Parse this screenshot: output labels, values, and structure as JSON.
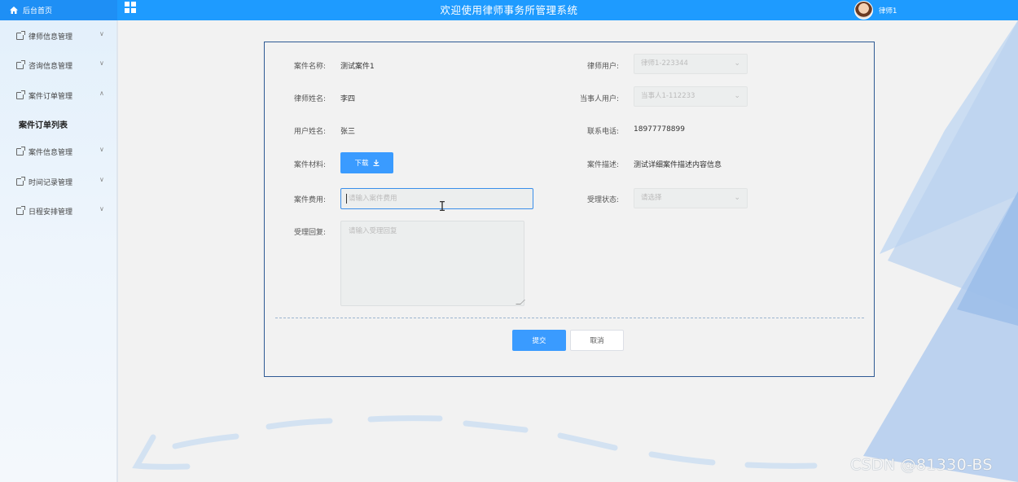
{
  "header": {
    "home_label": "后台首页",
    "title": "欢迎使用律师事务所管理系统",
    "user_name": "律师1"
  },
  "sidebar": {
    "items": [
      {
        "label": "律师信息管理",
        "expanded": false
      },
      {
        "label": "咨询信息管理",
        "expanded": false
      },
      {
        "label": "案件订单管理",
        "expanded": true
      },
      {
        "label": "案件信息管理",
        "expanded": false
      },
      {
        "label": "时间记录管理",
        "expanded": false
      },
      {
        "label": "日程安排管理",
        "expanded": false
      }
    ],
    "active_sub_item": "案件订单列表"
  },
  "form": {
    "case_name_label": "案件名称:",
    "case_name_value": "测试案件1",
    "lawyer_user_label": "律师用户:",
    "lawyer_user_value": "律师1-223344",
    "lawyer_name_label": "律师姓名:",
    "lawyer_name_value": "李四",
    "client_user_label": "当事人用户:",
    "client_user_value": "当事人1-112233",
    "user_name_label": "用户姓名:",
    "user_name_value": "张三",
    "phone_label": "联系电话:",
    "phone_value": "18977778899",
    "material_label": "案件材料:",
    "download_label": "下载",
    "desc_label": "案件描述:",
    "desc_value": "测试详细案件描述内容信息",
    "fee_label": "案件费用:",
    "fee_placeholder": "请输入案件费用",
    "status_label": "受理状态:",
    "status_placeholder": "请选择",
    "reply_label": "受理回复:",
    "reply_placeholder": "请输入受理回复",
    "submit_label": "提交",
    "cancel_label": "取消"
  },
  "watermark": "CSDN @81330-BS",
  "colors": {
    "topbar": "#1e9bff",
    "primary_button": "#3a9bff",
    "card_border": "#2e5a94"
  }
}
